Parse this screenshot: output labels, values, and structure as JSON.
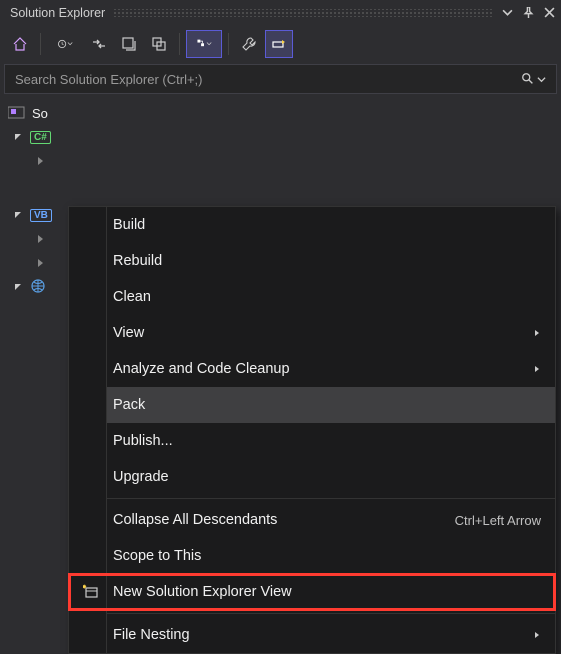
{
  "title": "Solution Explorer",
  "search": {
    "placeholder": "Search Solution Explorer (Ctrl+;)"
  },
  "tree": {
    "root_prefix": "So",
    "project_cs_tag": "C#",
    "project_vb_tag": "VB"
  },
  "menu": {
    "build": "Build",
    "rebuild": "Rebuild",
    "clean": "Clean",
    "view": "View",
    "analyze": "Analyze and Code Cleanup",
    "pack": "Pack",
    "publish": "Publish...",
    "upgrade": "Upgrade",
    "collapse": "Collapse All Descendants",
    "collapse_sc": "Ctrl+Left Arrow",
    "scope": "Scope to This",
    "newview": "New Solution Explorer View",
    "nesting": "File Nesting"
  }
}
